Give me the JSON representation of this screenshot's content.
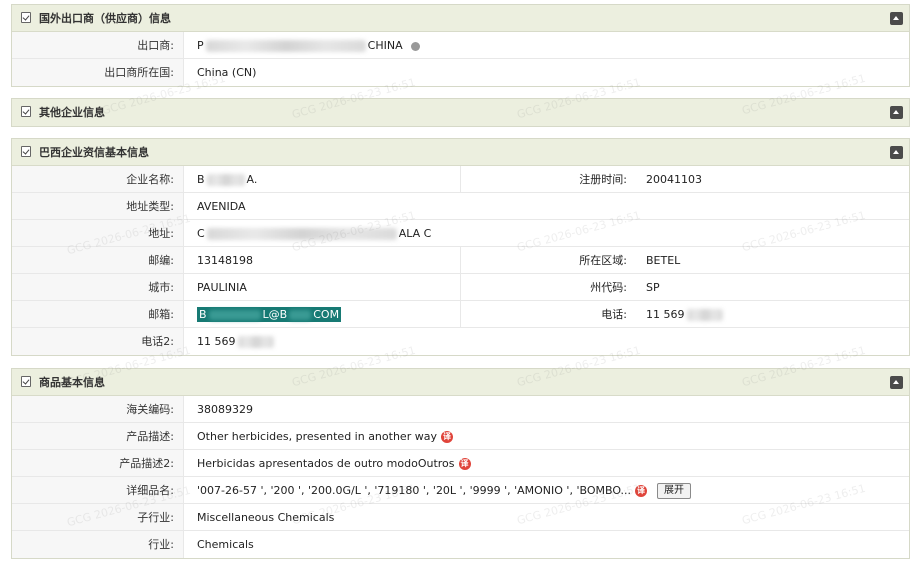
{
  "exporter_panel": {
    "title": "国外出口商（供应商）信息",
    "rows": [
      {
        "label": "出口商:",
        "value_start": "P",
        "value_end": "CHINA"
      },
      {
        "label": "出口商所在国:",
        "value": "China (CN)"
      }
    ]
  },
  "other_panel": {
    "title": "其他企业信息"
  },
  "brazil_panel": {
    "title": "巴西企业资信基本信息",
    "company_label": "企业名称:",
    "company_start": "B",
    "company_end": "A.",
    "reg_label": "注册时间:",
    "reg_value": "20041103",
    "addr_type_label": "地址类型:",
    "addr_type_value": "AVENIDA",
    "addr_label": "地址:",
    "addr_start": "C",
    "addr_end": "ALA C",
    "zip_label": "邮编:",
    "zip_value": "13148198",
    "district_label": "所在区域:",
    "district_value": "BETEL",
    "city_label": "城市:",
    "city_value": "PAULINIA",
    "state_label": "州代码:",
    "state_value": "SP",
    "email_label": "邮箱:",
    "email_a": "B",
    "email_b": "L@B",
    "email_c": "COM",
    "phone_label": "电话:",
    "phone_value": "11 569",
    "phone2_label": "电话2:",
    "phone2_value": "11 569"
  },
  "goods_panel": {
    "title": "商品基本信息",
    "hs_label": "海关编码:",
    "hs_value": "38089329",
    "desc_label": "产品描述:",
    "desc_value": "Other herbicides, presented in another way",
    "desc2_label": "产品描述2:",
    "desc2_value": "Herbicidas apresentados de outro modoOutros",
    "detail_label": "详细品名:",
    "detail_value": "'007-26-57 ', '200 ', '200.0G/L ', '719180 ', '20L ', '9999 ', 'AMONIO ', 'BOMBO...",
    "expand_label": "展开",
    "sub_label": "子行业:",
    "sub_value": "Miscellaneous Chemicals",
    "ind_label": "行业:",
    "ind_value": "Chemicals",
    "translate_glyph": "译"
  },
  "watermark": "GCG 2026-06-23 16:51",
  "colors": {
    "header_bg": "#ecefdf",
    "email_highlight": "#177a74",
    "translate_badge": "#e0443a"
  }
}
